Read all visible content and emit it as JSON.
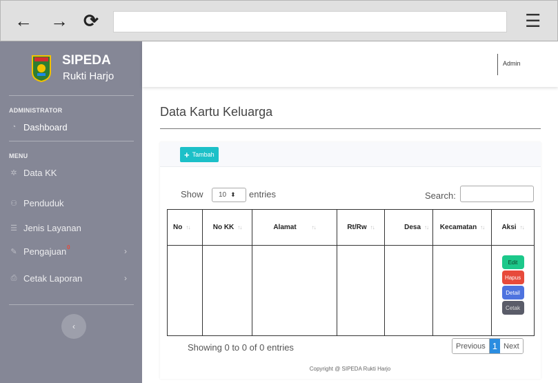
{
  "browser": {
    "back": "←",
    "forward": "→",
    "reload": "⟳",
    "menu": "☰",
    "url": ""
  },
  "brand": {
    "title": "SIPEDA",
    "subtitle": "Rukti Harjo"
  },
  "sidebar": {
    "heading_admin": "ADMINISTRATOR",
    "dashboard": "Dashboard",
    "heading_menu": "MENU",
    "items": [
      {
        "label": "Data KK",
        "icon": "cog-icon"
      },
      {
        "label": "Penduduk",
        "icon": "users-icon"
      },
      {
        "label": "Jenis Layanan",
        "icon": "list-icon"
      },
      {
        "label": "Pengajuan",
        "icon": "edit-icon",
        "badge": "0"
      },
      {
        "label": "Cetak Laporan",
        "icon": "print-icon"
      }
    ]
  },
  "topbar": {
    "user": "Admin"
  },
  "page": {
    "title": "Data Kartu Keluarga"
  },
  "card": {
    "add_label": "Tambah",
    "show_label": "Show",
    "page_length": "10",
    "entries_label": "entries",
    "search_label": "Search:",
    "search_value": ""
  },
  "table": {
    "columns": [
      "No",
      "No KK",
      "Alamat",
      "Rt/Rw",
      "Desa",
      "Kecamatan",
      "Aksi"
    ],
    "actions": [
      "Edit",
      "Hapus",
      "Detail",
      "Cetak"
    ]
  },
  "pagination": {
    "info": "Showing 0 to 0 of 0 entries",
    "previous": "Previous",
    "current": "1",
    "next": "Next"
  },
  "footer": "Copyright @ SIPEDA Rukti Harjo",
  "colors": {
    "sidebar": "#858796",
    "accent": "#1cc0c8",
    "edit": "#1cc88a",
    "hapus": "#e74a3b",
    "detail": "#4e73df",
    "cetak": "#5a5c69"
  }
}
